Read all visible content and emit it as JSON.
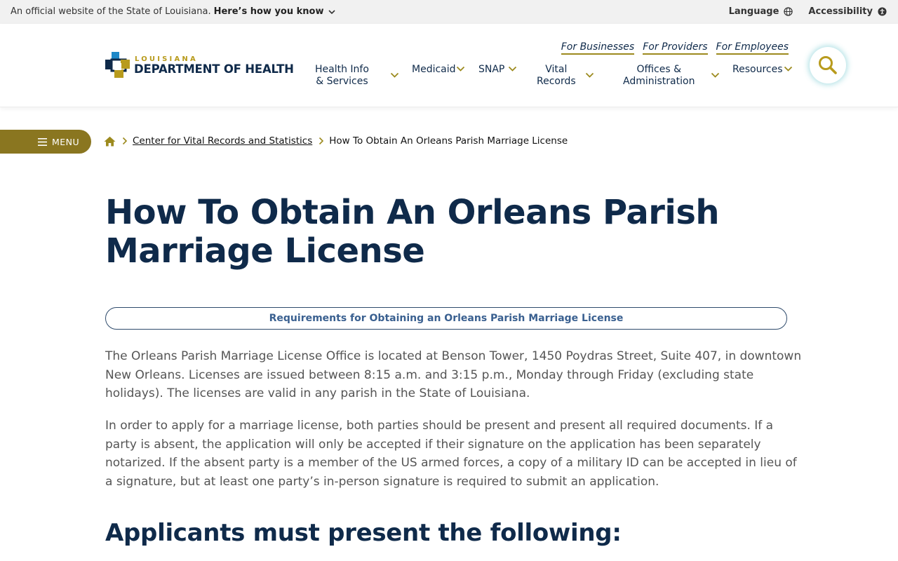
{
  "gov_banner": {
    "official_text": "An official website of the State of Louisiana.",
    "how_you_know": "Here’s how you know",
    "language": "Language",
    "accessibility": "Accessibility"
  },
  "header": {
    "logo_state": "LOUISIANA",
    "logo_dept": "DEPARTMENT OF HEALTH",
    "secondary_nav": [
      "For Businesses",
      "For Providers",
      "For Employees"
    ],
    "main_nav": [
      {
        "line1": "Health Info",
        "line2": "& Services"
      },
      {
        "line1": "Medicaid",
        "line2": ""
      },
      {
        "line1": "SNAP",
        "line2": ""
      },
      {
        "line1": "Vital",
        "line2": "Records"
      },
      {
        "line1": "Offices &",
        "line2": "Administration"
      },
      {
        "line1": "Resources",
        "line2": ""
      }
    ]
  },
  "menu_label": "MENU",
  "breadcrumb": {
    "link": "Center for Vital Records and Statistics",
    "current": "How To Obtain An Orleans Parish Marriage License"
  },
  "content": {
    "title": "How To Obtain An Orleans Parish Marriage License",
    "requirements_link": "Requirements for Obtaining an Orleans Parish Marriage License",
    "paragraph1": "The Orleans Parish Marriage License Office is located at Benson Tower, 1450 Poydras Street, Suite 407, in downtown New Orleans. Licenses are issued between 8:15 a.m. and 3:15 p.m., Monday through Friday (excluding state holidays). The licenses are valid in any parish in the State of Louisiana.",
    "paragraph2": "In order to apply for a marriage license, both parties should be present and present all required documents. If a party is absent, the application will only be accepted if their signature on the application has been separately notarized. If the absent party is a member of the US armed forces, a copy of a military ID can be accepted in lieu of a signature, but at least one party’s in-person signature is required to submit an application.",
    "subheading": "Applicants must present the following:"
  },
  "colors": {
    "navy": "#0f2a4a",
    "gold": "#9c8a1e",
    "menu_bg": "#8a7620",
    "link_blue": "#3a6090"
  }
}
